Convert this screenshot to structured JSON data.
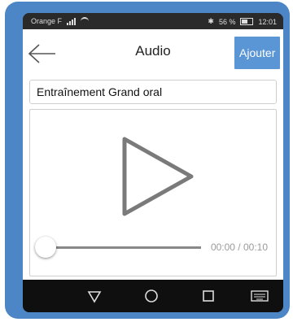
{
  "status": {
    "carrier": "Orange F",
    "battery": "56 %",
    "time": "12:01"
  },
  "appbar": {
    "title": "Audio",
    "add_label": "Ajouter"
  },
  "form": {
    "title_value": "Entraînement Grand oral"
  },
  "player": {
    "time_display": "00:00 / 00:10",
    "progress": 0
  },
  "icons": {
    "back": "back-arrow-icon",
    "play": "play-icon",
    "nav_back": "triangle-back-icon",
    "nav_home": "circle-home-icon",
    "nav_recents": "square-recents-icon",
    "nav_keyboard": "keyboard-icon"
  },
  "colors": {
    "frame": "#4d86c6",
    "accent": "#5a95d6"
  }
}
